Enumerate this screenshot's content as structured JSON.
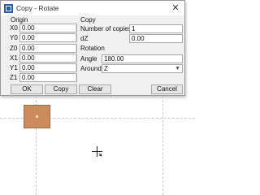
{
  "window": {
    "title": "Copy - Rotate",
    "close_glyph": "✕"
  },
  "origin": {
    "heading": "Origin",
    "rows": [
      {
        "label": "X0",
        "value": "0.00"
      },
      {
        "label": "Y0",
        "value": "0.00"
      },
      {
        "label": "Z0",
        "value": "0.00"
      },
      {
        "label": "X1",
        "value": "0.00"
      },
      {
        "label": "Y1",
        "value": "0.00"
      },
      {
        "label": "Z1",
        "value": "0.00"
      }
    ]
  },
  "copy": {
    "heading": "Copy",
    "number_of_copies_label": "Number of copies",
    "number_of_copies_value": "1",
    "dz_label": "dZ",
    "dz_value": "0.00"
  },
  "rotation": {
    "heading": "Rotation",
    "angle_label": "Angle",
    "angle_value": "180.00",
    "around_label": "Around",
    "around_value": "Z"
  },
  "buttons": {
    "ok": "OK",
    "copy": "Copy",
    "clear": "Clear",
    "cancel": "Cancel"
  },
  "colors": {
    "shape_fill": "#cd8a5a",
    "dialog_bg": "#f0f0f0"
  }
}
